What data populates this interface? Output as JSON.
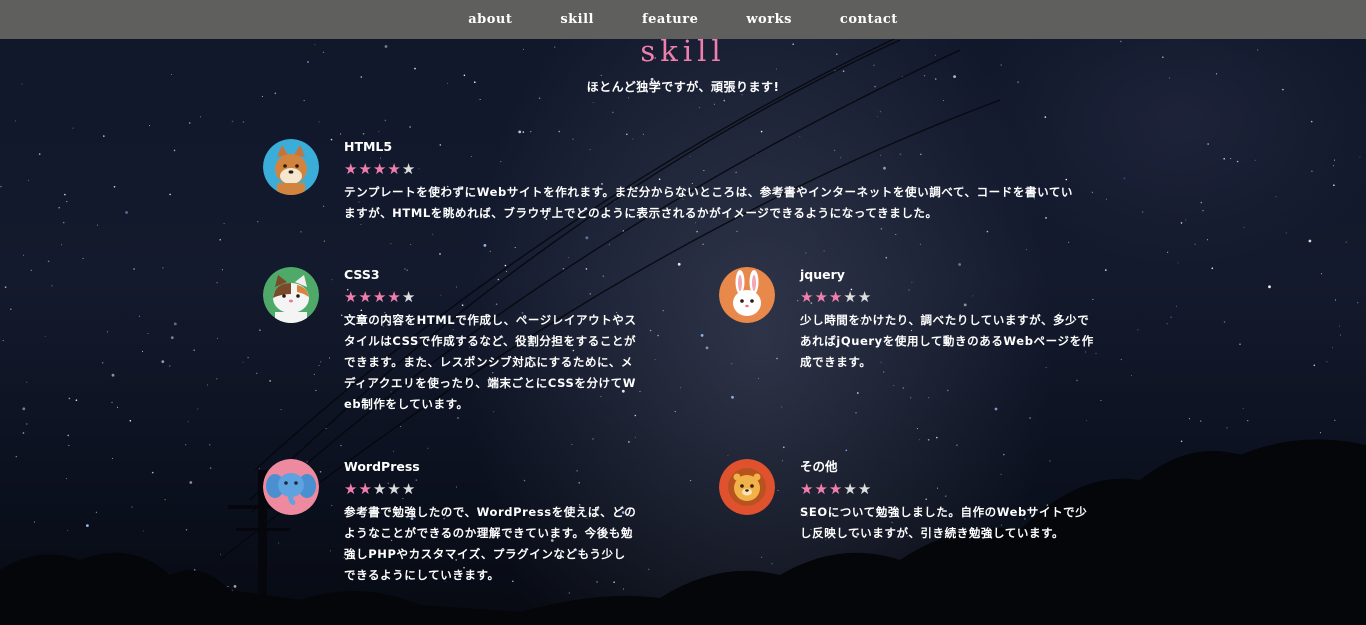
{
  "nav": {
    "items": [
      "about",
      "skill",
      "feature",
      "works",
      "contact"
    ]
  },
  "section": {
    "title": "skill",
    "subtitle": "ほとんど独学ですが、頑張ります!"
  },
  "colors": {
    "accent_pink": "#f07fae",
    "nav_bg": "#5f5f5e",
    "star_off": "#dddddd"
  },
  "skills": [
    {
      "name": "HTML5",
      "rating": 4,
      "max_rating": 5,
      "icon": "shiba-dog-icon",
      "icon_bg": "#3aaed8",
      "desc_lines": [
        "テンプレートを使わずにWebサイトを作れます。まだ分からないところは、参考書やインターネットを使い調べて、コードを書いてい",
        "ますが、HTMLを眺めれば、ブラウザ上でどのように表示されるかがイメージできるようになってきました。"
      ]
    },
    {
      "name": "CSS3",
      "rating": 4,
      "max_rating": 5,
      "icon": "calico-cat-icon",
      "icon_bg": "#4faa6a",
      "desc_lines": [
        "文章の内容をHTMLで作成し、ページレイアウトやス",
        "タイルはCSSで作成するなど、役割分担をすることが",
        "できます。また、レスポンシブ対応にするために、メ",
        "ディアクエリを使ったり、端末ごとにCSSを分けてW",
        "eb制作をしています。"
      ]
    },
    {
      "name": "jquery",
      "rating": 3,
      "max_rating": 5,
      "icon": "rabbit-icon",
      "icon_bg": "#e8884a",
      "desc_lines": [
        "少し時間をかけたり、調べたりしていますが、多少で",
        "あればjQueryを使用して動きのあるWebページを作",
        "成できます。"
      ]
    },
    {
      "name": "WordPress",
      "rating": 2,
      "max_rating": 5,
      "icon": "elephant-icon",
      "icon_bg": "#ee8aa0",
      "desc_lines": [
        "参考書で勉強したので、WordPressを使えば、どの",
        "ようなことができるのか理解できています。今後も勉",
        "強しPHPやカスタマイズ、プラグインなどもう少し",
        "できるようにしていきます。"
      ]
    },
    {
      "name": "その他",
      "rating": 3,
      "max_rating": 5,
      "icon": "lion-icon",
      "icon_bg": "#e0522e",
      "desc_lines": [
        "SEOについて勉強しました。自作のWebサイトで少",
        "し反映していますが、引き続き勉強しています。"
      ]
    }
  ]
}
